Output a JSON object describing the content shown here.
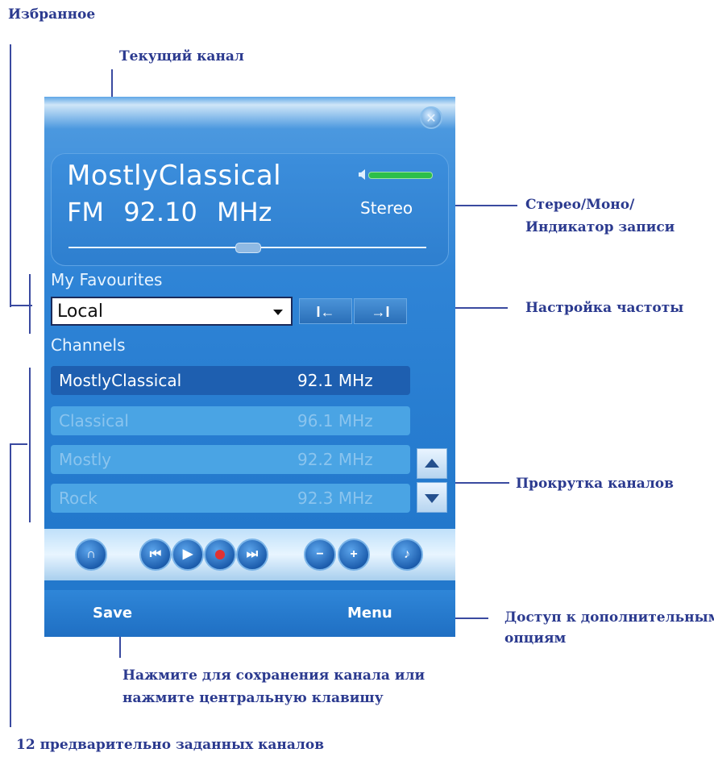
{
  "annotations": {
    "favorites": "Избранное",
    "current_channel": "Текущий канал",
    "stereo_mono_line1": "Стерео/Моно/",
    "stereo_mono_line2": "Индикатор записи",
    "tuning": "Настройка частоты",
    "scroll_channels": "Прокрутка каналов",
    "more_options_line1": "Доступ к дополнительным",
    "more_options_line2": "опциям",
    "save_hint_line1": "Нажмите для сохранения канала  или",
    "save_hint_line2": "нажмите центральную клавишу",
    "presets": "12 предварительно заданных  каналов"
  },
  "player": {
    "close_icon": "close-icon",
    "station_name": "MostlyClassical",
    "frequency": "FM 92.10   MHz",
    "audio_mode": "Stereo",
    "tuning_position": 0.5,
    "favourites_label": "My Favourites",
    "favourites_value": "Local",
    "seek_back_icon": "seek-back-icon",
    "seek_forward_icon": "seek-forward-icon",
    "channels_label": "Channels",
    "channels": [
      {
        "name": "MostlyClassical",
        "freq": "92.1 MHz",
        "selected": true
      },
      {
        "name": "Classical",
        "freq": "96.1 MHz",
        "selected": false
      },
      {
        "name": "Mostly",
        "freq": "92.2 MHz",
        "selected": false
      },
      {
        "name": "Rock",
        "freq": "92.3 MHz",
        "selected": false
      }
    ],
    "controls": [
      "headphones-icon",
      "previous-icon",
      "play-icon",
      "record-icon",
      "next-icon",
      "volume-down-icon",
      "volume-up-icon",
      "music-note-icon"
    ],
    "softkeys": {
      "left": "Save",
      "right": "Menu"
    }
  },
  "colors": {
    "callout": "#2b3a8f",
    "screen": "#2f84d6",
    "selected_row": "#1e5fb0",
    "record": "#e23232"
  }
}
